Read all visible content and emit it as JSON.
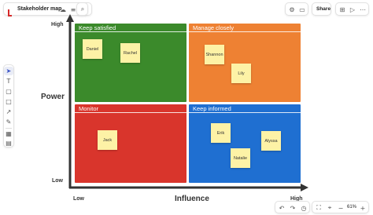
{
  "app": {
    "title": "Stakeholder map"
  },
  "toolbar": {
    "share_label": "Share"
  },
  "matrix": {
    "y_axis_label": "Power",
    "x_axis_label": "Influence",
    "y_high": "High",
    "y_low": "Low",
    "x_low": "Low",
    "x_high": "High",
    "quadrants": {
      "keep_satisfied": {
        "title": "Keep satisfied",
        "color": "#3b8a2b",
        "notes": [
          "Daniel",
          "Rachel"
        ]
      },
      "manage_closely": {
        "title": "Manage closely",
        "color": "#ee8133",
        "notes": [
          "Shannon",
          "Lily"
        ]
      },
      "monitor": {
        "title": "Monitor",
        "color": "#d9352c",
        "notes": [
          "Jack"
        ]
      },
      "keep_informed": {
        "title": "Keep informed",
        "color": "#1f6fd1",
        "notes": [
          "Erik",
          "Alyssa",
          "Natalie"
        ]
      }
    }
  },
  "zoom": {
    "level": "61%"
  }
}
